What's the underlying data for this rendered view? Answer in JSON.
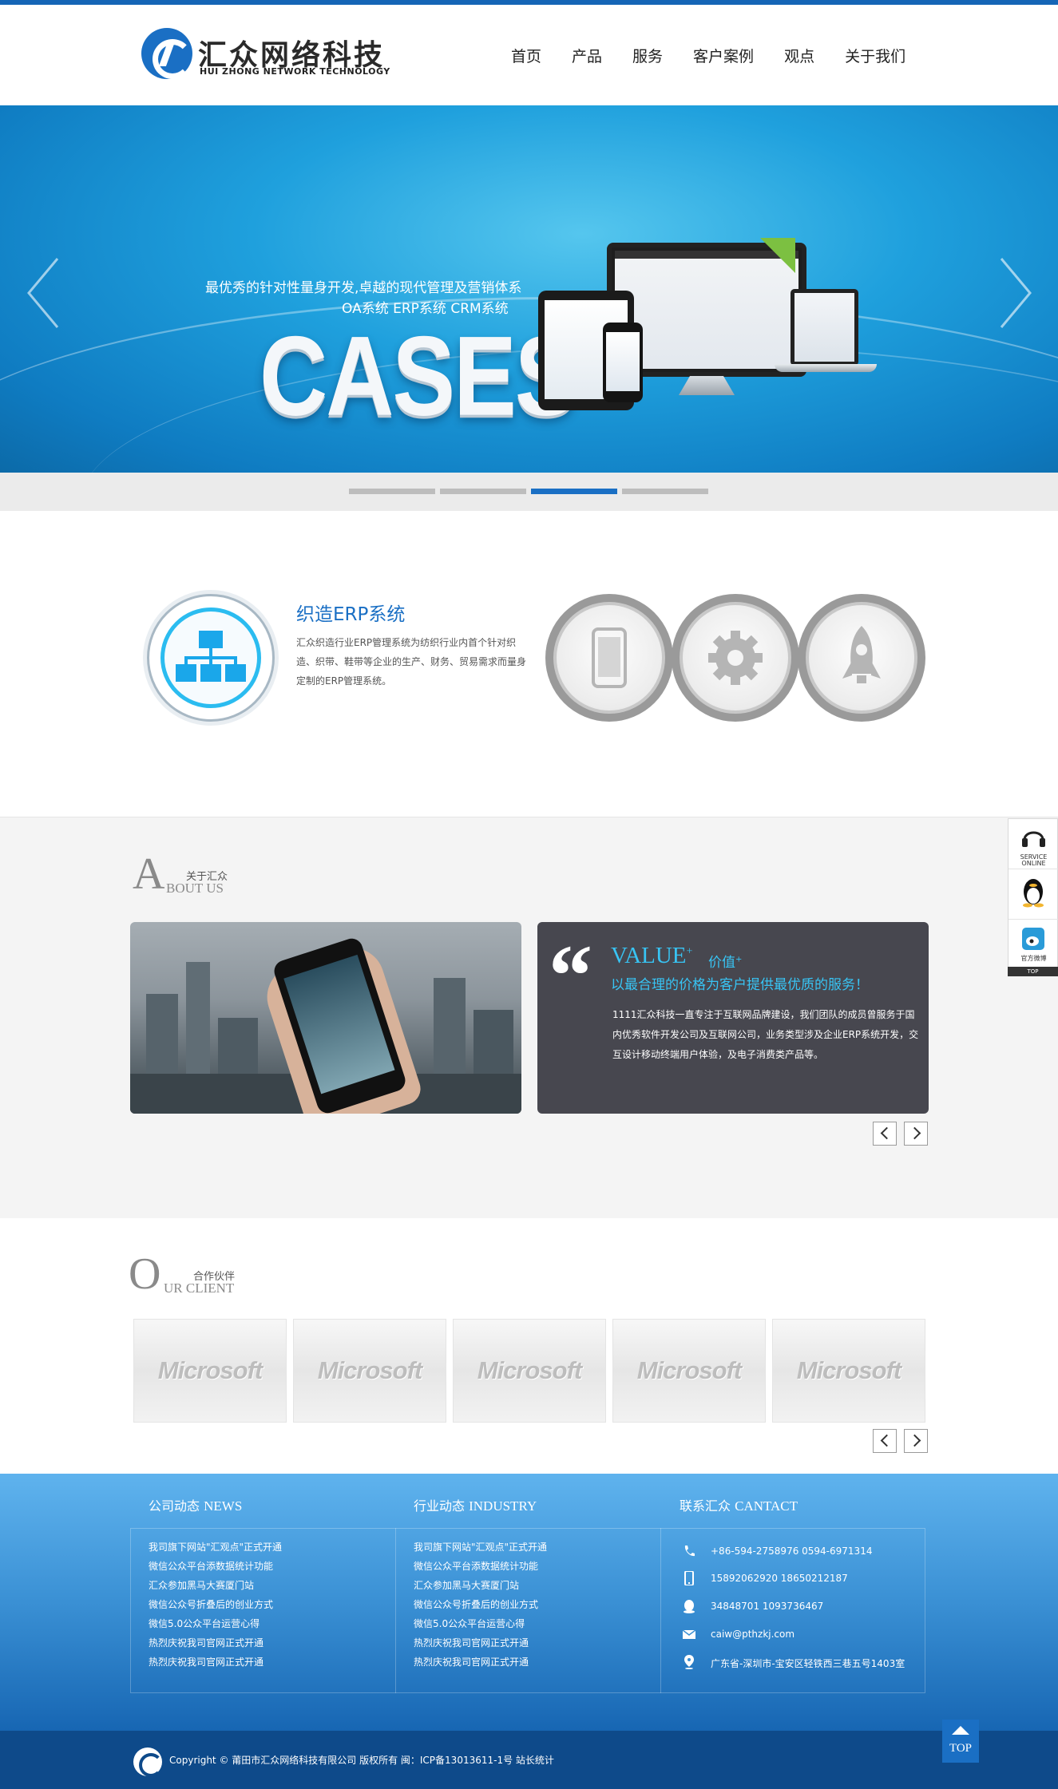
{
  "brand": {
    "name_cn": "汇众网络科技",
    "name_en": "HUI ZHONG NETWORK TECHNOLOGY"
  },
  "nav": [
    "首页",
    "产品",
    "服务",
    "客户案例",
    "观点",
    "关于我们"
  ],
  "banner": {
    "line1": "最优秀的针对性量身开发,卓越的现代管理及营销体系",
    "line2": "OA系统 ERP系统 CRM系统",
    "headline": "CASES",
    "active_slide": 3,
    "slide_count": 4
  },
  "feature": {
    "title": "织造ERP系统",
    "desc": "汇众织造行业ERP管理系统为纺织行业内首个针对织造、织带、鞋带等企业的生产、财务、贸易需求而量身定制的ERP管理系统。",
    "icons": [
      "sitemap-icon",
      "mobile-icon",
      "gear-icon",
      "rocket-icon"
    ]
  },
  "about": {
    "big": "A",
    "en": "BOUT US",
    "cn": "关于汇众",
    "value_title": "VALUE",
    "value_sup": "+",
    "value_cn": "价值",
    "value_cn_sup": "+",
    "value_sub": "以最合理的价格为客户提供最优质的服务！",
    "value_desc": "1111汇众科技一直专注于互联网品牌建设，我们团队的成员曾服务于国内优秀软件开发公司及互联网公司，业务类型涉及企业ERP系统开发，交互设计移动终端用户体验，及电子消费类产品等。"
  },
  "clients": {
    "big": "O",
    "en": "UR CLIENT",
    "cn": "合作伙伴",
    "logos": [
      "Microsoft",
      "Microsoft",
      "Microsoft",
      "Microsoft",
      "Microsoft"
    ]
  },
  "footer": {
    "news_head_cn": "公司动态",
    "news_head_en": "NEWS",
    "industry_head_cn": "行业动态",
    "industry_head_en": "INDUSTRY",
    "contact_head_cn": "联系汇众",
    "contact_head_en": "CANTACT",
    "news": [
      "我司旗下网站\"汇观点\"正式开通",
      "微信公众平台添数据统计功能",
      "汇众参加黑马大赛厦门站",
      "微信公众号折叠后的创业方式",
      "微信5.0公众平台运营心得",
      "热烈庆祝我司官网正式开通",
      "热烈庆祝我司官网正式开通"
    ],
    "industry": [
      "我司旗下网站\"汇观点\"正式开通",
      "微信公众平台添数据统计功能",
      "汇众参加黑马大赛厦门站",
      "微信公众号折叠后的创业方式",
      "微信5.0公众平台运营心得",
      "热烈庆祝我司官网正式开通",
      "热烈庆祝我司官网正式开通"
    ],
    "contact": {
      "phone": "+86-594-2758976 0594-6971314",
      "mobile": "15892062920 18650212187",
      "qq": "34848701 1093736467",
      "email": "caiw@pthzkj.com",
      "address": "广东省-深圳市-宝安区轻铁西三巷五号1403室"
    },
    "copyright": "Copyright © 莆田市汇众网络科技有限公司 版权所有 闽：ICP备13013611-1号 站长统计",
    "top_label": "TOP"
  },
  "side_widget": {
    "service_l1": "SERVICE",
    "service_l2": "ONLINE",
    "weibo": "官方微博",
    "top": "TOP"
  },
  "colors": {
    "brand_blue": "#1a6fc4",
    "accent_cyan": "#38c4f4",
    "card_dark": "#47474f"
  }
}
